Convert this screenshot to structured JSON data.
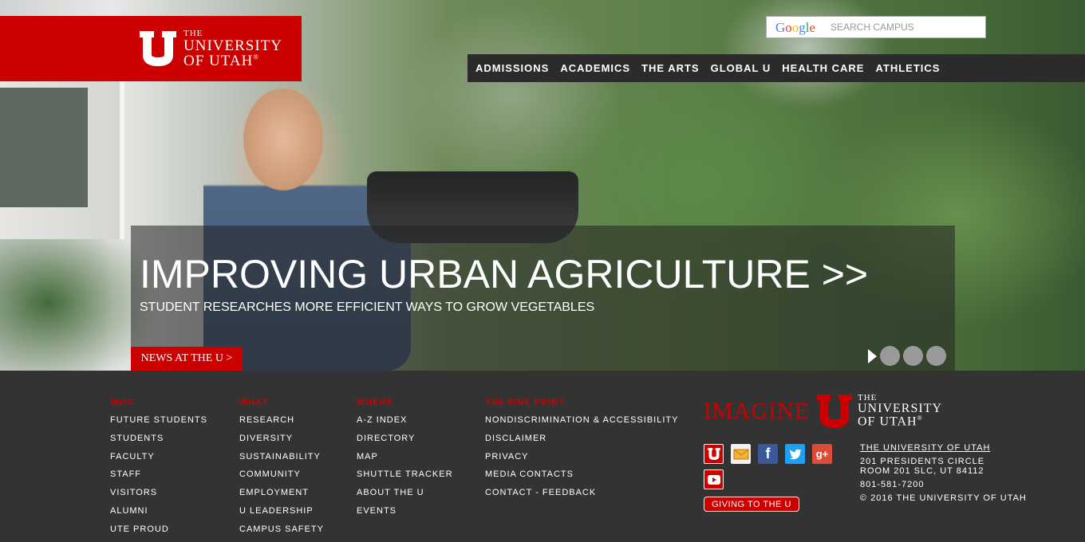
{
  "search": {
    "placeholder": "SEARCH CAMPUS",
    "logo": [
      "G",
      "o",
      "o",
      "g",
      "l",
      "e"
    ]
  },
  "logo": {
    "line1": "THE",
    "line2": "UNIVERSITY",
    "line3": "OF UTAH",
    "reg": "®"
  },
  "nav": {
    "items": [
      "ADMISSIONS",
      "ACADEMICS",
      "THE ARTS",
      "GLOBAL U",
      "HEALTH CARE",
      "ATHLETICS"
    ]
  },
  "hero": {
    "headline": "IMPROVING URBAN AGRICULTURE >>",
    "subhead": "STUDENT RESEARCHES MORE EFFICIENT WAYS TO GROW VEGETABLES",
    "news_button": "NEWS AT THE U >"
  },
  "footer": {
    "who": {
      "heading": "WHO",
      "items": [
        "FUTURE STUDENTS",
        "STUDENTS",
        "FACULTY",
        "STAFF",
        "VISITORS",
        "ALUMNI",
        "UTE PROUD"
      ]
    },
    "what": {
      "heading": "WHAT",
      "items": [
        "RESEARCH",
        "DIVERSITY",
        "SUSTAINABILITY",
        "COMMUNITY",
        "EMPLOYMENT",
        "U LEADERSHIP",
        "CAMPUS SAFETY"
      ]
    },
    "where": {
      "heading": "WHERE",
      "items": [
        "A-Z INDEX",
        "DIRECTORY",
        "MAP",
        "SHUTTLE TRACKER",
        "ABOUT THE U",
        "EVENTS"
      ]
    },
    "fineprint": {
      "heading": "THE FINE PRINT",
      "items": [
        "NONDISCRIMINATION & ACCESSIBILITY",
        "DISCLAIMER",
        "PRIVACY",
        "MEDIA CONTACTS",
        "CONTACT - FEEDBACK"
      ]
    },
    "imagine": "IMAGINE",
    "uni_line1": "THE",
    "uni_line2": "UNIVERSITY",
    "uni_line3": "OF UTAH",
    "uni_reg": "®",
    "giving": "GIVING TO THE U",
    "address": {
      "name": "THE UNIVERSITY OF UTAH",
      "line1": "201 PRESIDENTS CIRCLE",
      "line2": "ROOM 201 SLC, UT 84112",
      "phone": "801-581-7200",
      "copyright": "© 2016 THE UNIVERSITY OF UTAH"
    },
    "social": {
      "facebook": "f",
      "gplus": "g+"
    }
  },
  "colors": {
    "brand_red": "#cc0000",
    "footer_bg": "#333333",
    "nav_bg": "#2b2b2b"
  }
}
